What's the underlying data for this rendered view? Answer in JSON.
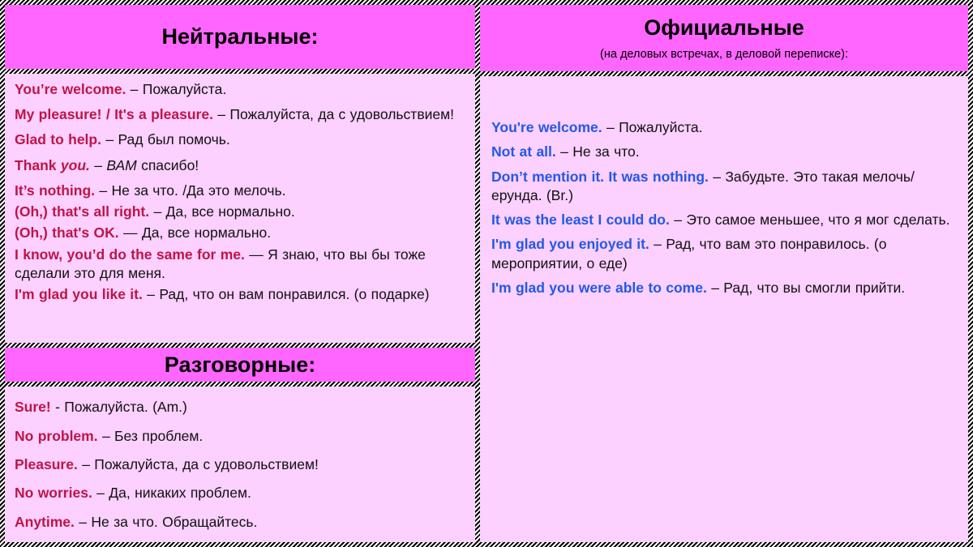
{
  "colors": {
    "banner_bg": "#ff66ff",
    "pane_bg": "#fcd0ff",
    "english_neutral": "#bd1548",
    "english_official": "#2358e8",
    "russian": "#111111",
    "border": "#000000"
  },
  "left_column": {
    "neutral_header": {
      "title": "Нейтральные:"
    },
    "neutral_entries": [
      {
        "en": "You’re welcome.",
        "ru": " – Пожалуйста."
      },
      {
        "en": "My pleasure! / It's a pleasure.",
        "ru": " – Пожалуйста, да с удовольствием!"
      },
      {
        "en": "Glad to help.",
        "ru": "  – Рад был помочь."
      },
      {
        "en": "Thank ",
        "en_italic": "you.",
        "ru": "  – ",
        "ru_italic": "ВАМ",
        "ru_tail": " спасибо!"
      },
      {
        "en": "It’s nothing.",
        "ru": " – Не за что. /Да это мелочь."
      },
      {
        "en": "(Oh,) that's all right.",
        "ru": " – Да, все нормально."
      },
      {
        "en": "(Oh,) that's OK.",
        "ru": "  —   Да, все нормально."
      },
      {
        "en": "I know, you’d do the same for me.",
        "ru": "  —   Я знаю, что вы бы тоже сделали это для меня."
      },
      {
        "en": "I'm glad you like it.",
        "ru": " – Рад, что он вам понравился. (о подарке)"
      }
    ],
    "colloquial_header": {
      "title": "Разговорные:"
    },
    "colloquial_entries": [
      {
        "en": "Sure!",
        "ru": "  - Пожалуйста. (Am.)"
      },
      {
        "en": "No problem.",
        "ru": " – Без проблем."
      },
      {
        "en": "Pleasure.",
        "ru": " – Пожалуйста, да с удовольствием!"
      },
      {
        "en": "No worries.",
        "ru": "  – Да, никаких проблем."
      },
      {
        "en": "Anytime.",
        "ru": "  – Не за что. Обращайтесь."
      }
    ]
  },
  "right_column": {
    "official_header": {
      "title": "Официальные",
      "subtitle": "(на деловых встречах, в деловой переписке):"
    },
    "official_entries": [
      {
        "en": "You're welcome.",
        "ru": "  – Пожалуйста."
      },
      {
        "en": "Not at all.",
        "ru": "  – Не за что."
      },
      {
        "en": "Don’t mention it. It was nothing.",
        "ru": " – Забудьте. Это такая мелочь/ерунда. (Br.)"
      },
      {
        "en": "It was the least I could do.",
        "ru": " – Это самое меньшее, что я мог сделать."
      },
      {
        "en": "I'm glad you enjoyed it.",
        "ru": " – Рад, что вам это понравилось. (о мероприятии, о еде)"
      },
      {
        "en": "I'm glad you were able to come.",
        "ru": "  – Рад, что вы смогли прийти."
      }
    ]
  }
}
